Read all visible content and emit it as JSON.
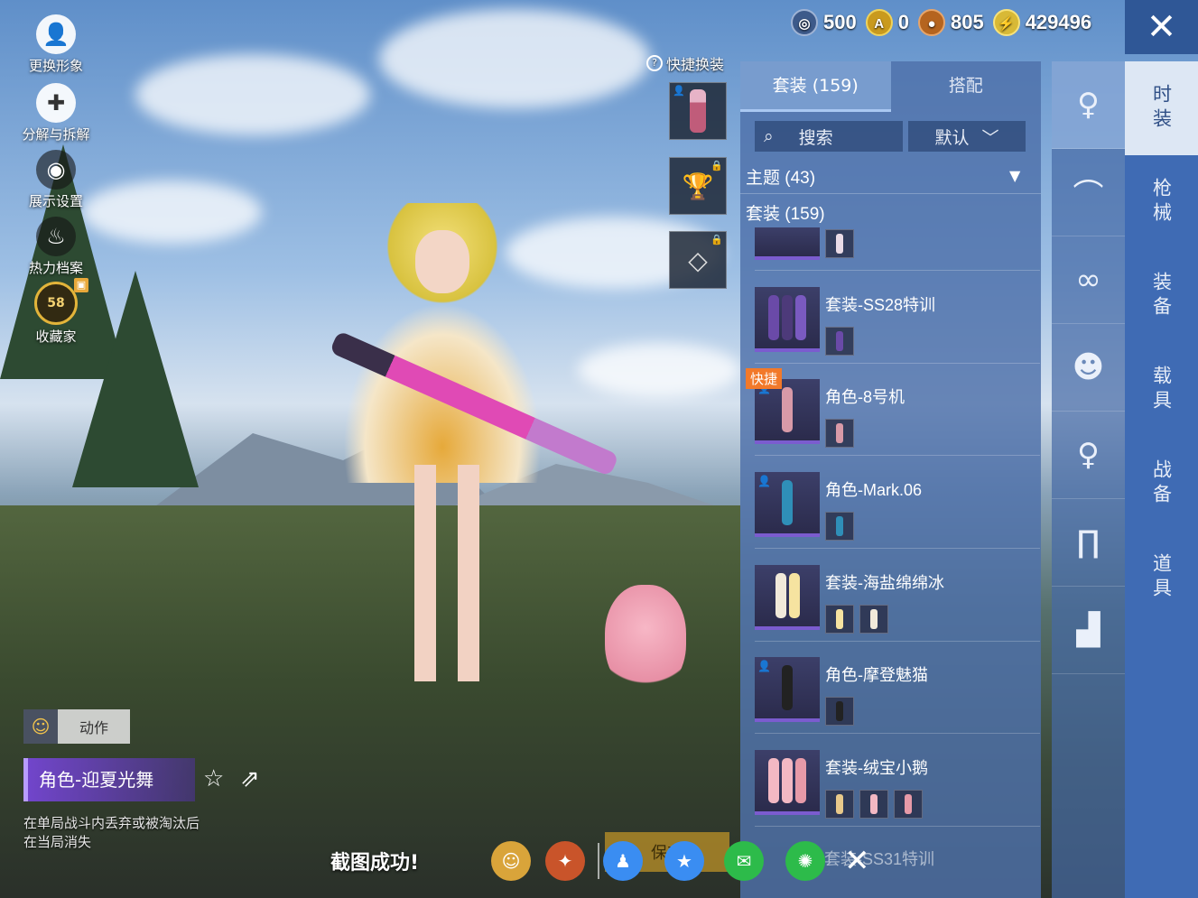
{
  "left_menu": {
    "items": [
      {
        "label": "更换形象",
        "icon": "avatar-icon"
      },
      {
        "label": "分解与拆解",
        "icon": "puzzle-icon"
      },
      {
        "label": "展示设置",
        "icon": "eye-icon"
      },
      {
        "label": "热力档案",
        "icon": "flame-icon"
      },
      {
        "label": "收藏家",
        "icon": "collector-badge-icon",
        "level": "58"
      }
    ]
  },
  "quick_change": {
    "label": "快捷换装",
    "help_icon": "?"
  },
  "currencies": [
    {
      "icon": "coin-silver-icon",
      "value": "500",
      "color": "#3d5a8a"
    },
    {
      "icon": "coin-gold-a-icon",
      "value": "0",
      "color": "#c99a1e"
    },
    {
      "icon": "coin-bronze-icon",
      "value": "805",
      "color": "#b5641f"
    },
    {
      "icon": "coin-lightning-icon",
      "value": "429496",
      "color": "#d8b936"
    }
  ],
  "panel": {
    "tabs": [
      {
        "label": "套装 (159)",
        "active": true
      },
      {
        "label": "搭配",
        "active": false
      }
    ],
    "search_label": "搜索",
    "sort_label": "默认",
    "theme_header": "主题 (43)",
    "suit_header": "套装 (159)",
    "items": [
      {
        "name": "套装-SS28特训",
        "quick": false,
        "person": false
      },
      {
        "name": "角色-8号机",
        "quick": true,
        "quick_label": "快捷",
        "person": true
      },
      {
        "name": "角色-Mark.06",
        "quick": false,
        "person": true
      },
      {
        "name": "套装-海盐绵绵冰",
        "quick": false,
        "person": false
      },
      {
        "name": "角色-摩登魅猫",
        "quick": false,
        "person": true
      },
      {
        "name": "套装-绒宝小鹅",
        "quick": false,
        "person": false
      }
    ],
    "faded_item": "套装-SS31特训"
  },
  "icon_column": [
    "outfit-icon",
    "cap-icon",
    "glasses-icon",
    "mask-icon",
    "figure-icon",
    "pants-icon",
    "boots-icon"
  ],
  "categories": [
    {
      "label": "时装",
      "active": true
    },
    {
      "label": "枪械",
      "active": false
    },
    {
      "label": "装备",
      "active": false
    },
    {
      "label": "载具",
      "active": false
    },
    {
      "label": "战备",
      "active": false
    },
    {
      "label": "道具",
      "active": false
    }
  ],
  "bottom": {
    "action_label": "动作",
    "character_name": "角色-迎夏光舞",
    "note_line1": "在单局战斗内丢弃或被淘汰后",
    "note_line2": "在当局消失"
  },
  "toast": {
    "message": "截图成功!",
    "save_label": "保存"
  },
  "colors": {
    "accent": "#7b5ccf",
    "panel": "#4e70aa",
    "category_bar": "#3f6bb4",
    "quick_tag": "#f2792a"
  }
}
